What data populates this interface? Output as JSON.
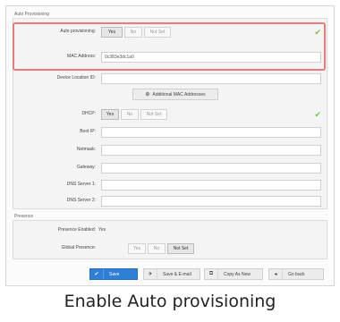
{
  "auto_provisioning": {
    "title": "Auto Provisioning",
    "auto_provisioning_label": "Auto provisioning:",
    "options": [
      "Yes",
      "No",
      "Not Set"
    ],
    "mac_label": "MAC Address:",
    "mac_value": "0c383e3dc1a0",
    "device_location_label": "Device Location ID:",
    "add_mac_label": "Additional MAC Addresses",
    "dhcp_label": "DHCP:",
    "boot_ip_label": "Boot IP:",
    "netmask_label": "Netmask:",
    "gateway_label": "Gateway:",
    "dns1_label": "DNS Server 1:",
    "dns2_label": "DNS Server 2:"
  },
  "presence": {
    "title": "Presence",
    "enabled_label": "Presence Enabled:",
    "enabled_value": "Yes",
    "global_label": "Global Presence:",
    "options": [
      "Yes",
      "No",
      "Not Set"
    ]
  },
  "actions": {
    "save": "Save",
    "save_email": "Save & E-mail",
    "copy_new": "Copy As New",
    "go_back": "Go back"
  },
  "caption": "Enable Auto provisioning",
  "colors": {
    "accent": "#2f7fd6",
    "highlight": "#e97b7b",
    "check": "#7fbf3f"
  }
}
